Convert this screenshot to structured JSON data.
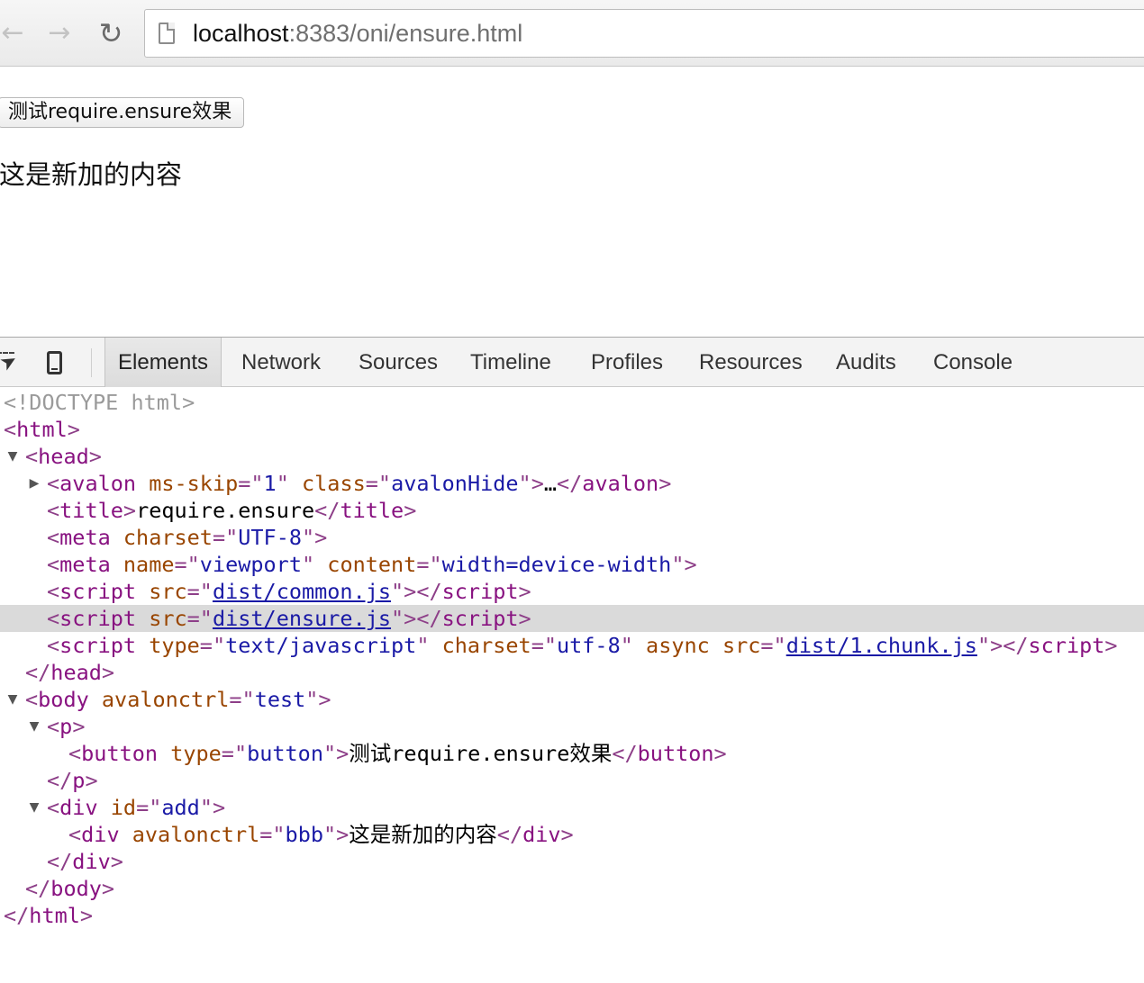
{
  "browser": {
    "url_host": "localhost",
    "url_rest": ":8383/oni/ensure.html",
    "icons": {
      "back": "arrow-left-icon",
      "forward": "arrow-right-icon",
      "reload": "reload-icon",
      "page": "page-icon"
    }
  },
  "page": {
    "button_label": "测试require.ensure效果",
    "added_text": "这是新加的内容"
  },
  "devtools": {
    "tabs": [
      "Elements",
      "Network",
      "Sources",
      "Timeline",
      "Profiles",
      "Resources",
      "Audits",
      "Console"
    ],
    "active_tab": "Elements",
    "icons": {
      "inspect": "inspect-element-icon",
      "device": "device-mode-icon"
    }
  },
  "dom": {
    "doctype": "<!DOCTYPE html>",
    "html_tag": "html",
    "head_tag": "head",
    "avalon_tag": "avalon",
    "ms_skip_attr": "ms-skip",
    "ms_skip_value": "1",
    "class_attr": "class",
    "class_value": "avalonHide",
    "ellipsis": "…",
    "title_tag": "title",
    "title_text": "require.ensure",
    "meta_tag": "meta",
    "charset_attr": "charset",
    "charset_value": "UTF-8",
    "name_attr": "name",
    "name_value": "viewport",
    "content_attr": "content",
    "content_value": "width=device-width",
    "script_tag": "script",
    "src_attr": "src",
    "script1_src": "dist/common.js",
    "script2_src": "dist/ensure.js",
    "type_attr": "type",
    "script3_type": "text/javascript",
    "script3_charset": "utf-8",
    "async_attr": "async",
    "script3_src": "dist/1.chunk.js",
    "body_tag": "body",
    "avalonctrl_attr": "avalonctrl",
    "body_ctrl": "test",
    "p_tag": "p",
    "button_tag": "button",
    "button_type": "button",
    "button_text": "测试require.ensure效果",
    "div_tag": "div",
    "id_attr": "id",
    "div_id": "add",
    "inner_ctrl": "bbb",
    "inner_text": "这是新加的内容"
  },
  "colors": {
    "tag": "#881280",
    "attr_name": "#994500",
    "attr_value": "#1a1aa6",
    "selection": "#dadada"
  }
}
